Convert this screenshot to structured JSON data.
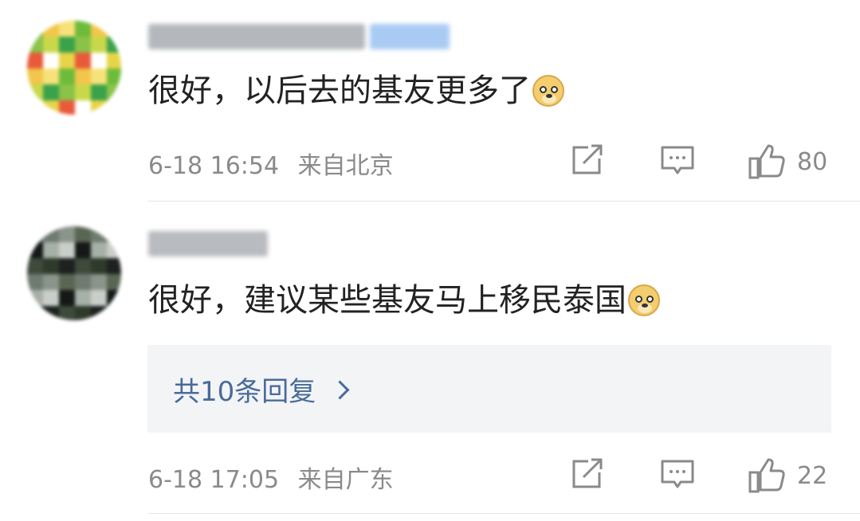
{
  "comments": [
    {
      "text": "很好，以后去的基友更多了",
      "emoji": "doge-emoji",
      "timestamp": "6-18 16:54",
      "location": "来自北京",
      "likes": "80",
      "avatar_colors": [
        "#6dbb3a",
        "#c9d84a",
        "#e7d448",
        "#f2c64a",
        "#3aa24a",
        "#e85a3a",
        "#f7e27a",
        "#8bc34a",
        "#ffffff"
      ],
      "username_colors": [
        "#9aa0a6",
        "#c3c7cc"
      ],
      "badge_color": "#9fc3f0"
    },
    {
      "text": "很好，建议某些基友马上移民泰国",
      "emoji": "doge-emoji",
      "timestamp": "6-18 17:05",
      "location": "来自广东",
      "likes": "22",
      "replies_label": "共10条回复",
      "avatar_colors": [
        "#2f3a2a",
        "#5a6654",
        "#a7b0a8",
        "#1d2120",
        "#6f7a70",
        "#c9cfc8",
        "#3e4a3c",
        "#8a948a",
        "#141816"
      ],
      "username_colors": [
        "#a4a8ad",
        "#c9ccd0"
      ]
    }
  ],
  "icons": {
    "share": "share-icon",
    "comment": "comment-icon",
    "like": "thumbs-up-icon",
    "chevron": "chevron-right-icon"
  }
}
